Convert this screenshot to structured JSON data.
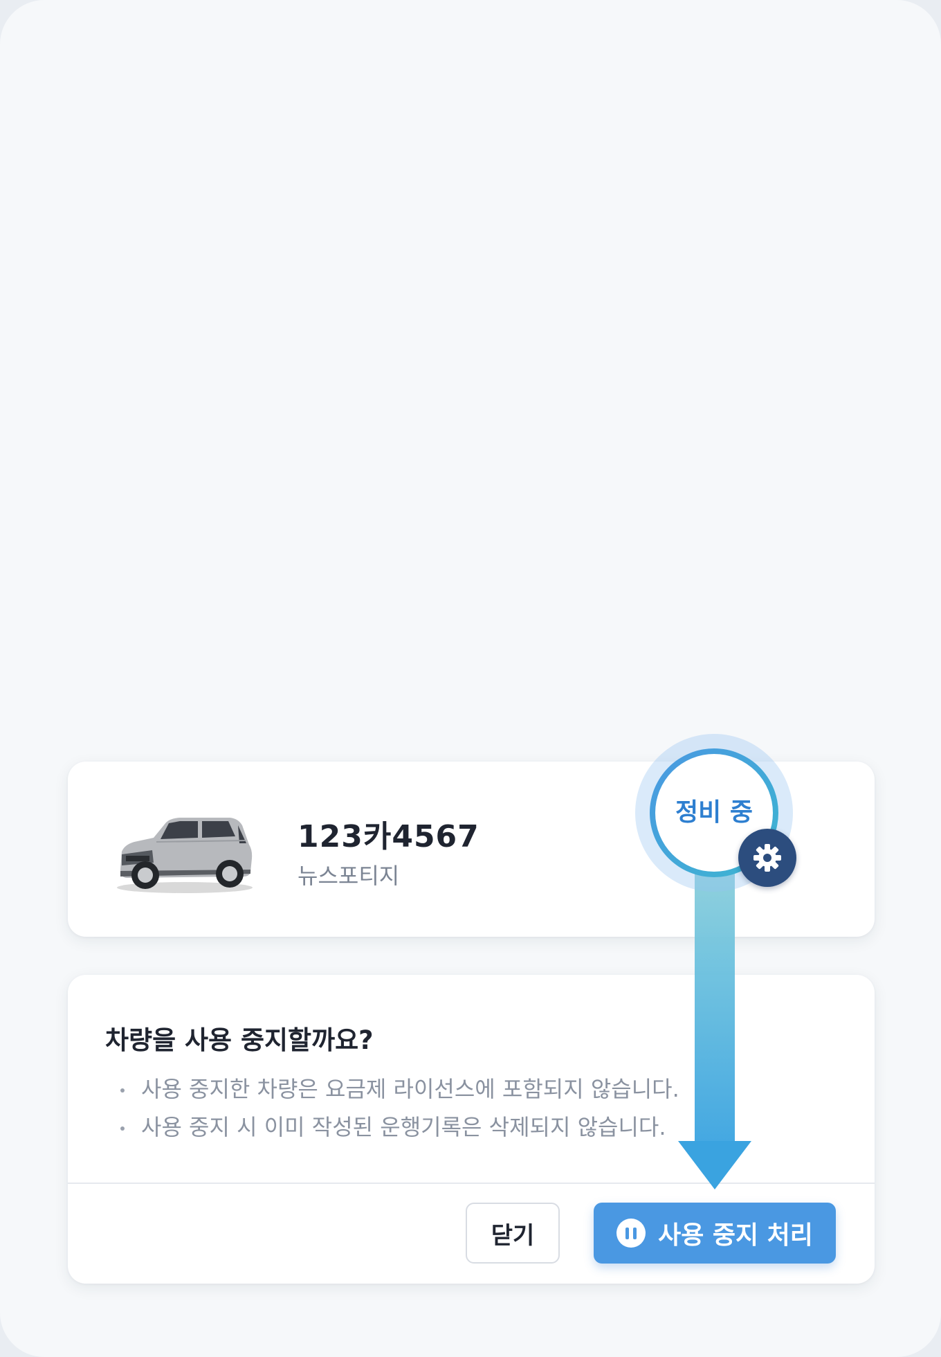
{
  "vehicle": {
    "plate": "123카4567",
    "model": "뉴스포티지",
    "status": "정비 중"
  },
  "dialog": {
    "title": "차량을 사용 중지할까요?",
    "notes": [
      "사용 중지한 차량은 요금제 라이선스에 포함되지 않습니다.",
      "사용 중지 시 이미 작성된 운행기록은 삭제되지 않습니다."
    ],
    "close_label": "닫기",
    "confirm_label": "사용 중지 처리"
  },
  "colors": {
    "primary": "#4a98e2",
    "badge_dark": "#2c4d7e",
    "arrow_top": "#8fd0da",
    "arrow_bottom": "#3aa3e0"
  },
  "icons": {
    "status_badge": "gear-icon",
    "confirm_button": "pause-circle-icon",
    "vehicle_image": "suv-car-icon"
  }
}
